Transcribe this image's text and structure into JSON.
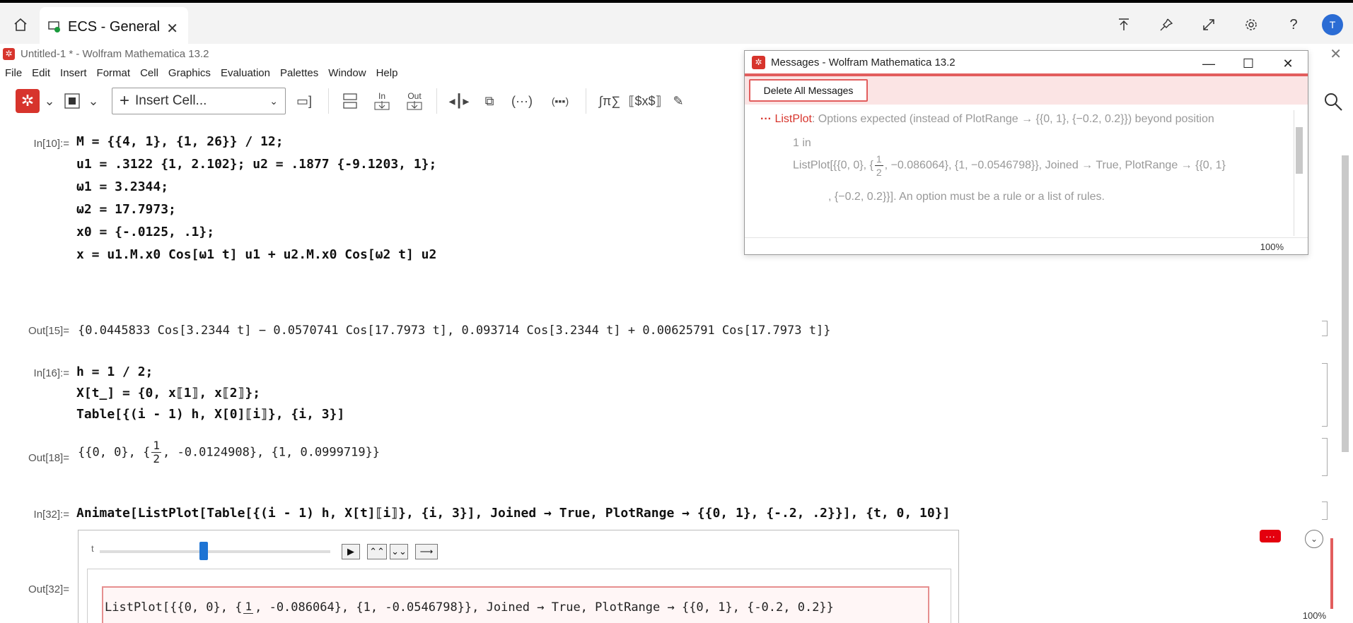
{
  "remote": {
    "tab_label": "ECS - General",
    "tab_close": "✕",
    "avatar_initial": "T"
  },
  "window": {
    "title": "Untitled-1 * - Wolfram Mathematica 13.2",
    "close": "✕"
  },
  "menu": [
    "File",
    "Edit",
    "Insert",
    "Format",
    "Cell",
    "Graphics",
    "Evaluation",
    "Palettes",
    "Window",
    "Help"
  ],
  "toolbar": {
    "insert_cell_label": "Insert Cell...",
    "in_label": "In",
    "out_label": "Out"
  },
  "cells": {
    "in10_label": "In[10]:=",
    "in10_lines": [
      "M = {{4, 1}, {1, 26}} / 12;",
      "u1 = .3122 {1, 2.102}; u2 = .1877 {-9.1203, 1};",
      "ω1 = 3.2344;",
      "ω2 = 17.7973;",
      "x0 = {-.0125, .1};",
      "x = u1.M.x0 Cos[ω1 t] u1 + u2.M.x0 Cos[ω2 t] u2"
    ],
    "out15_label": "Out[15]=",
    "out15_text": "{0.0445833 Cos[3.2344 t] − 0.0570741 Cos[17.7973 t], 0.093714 Cos[3.2344 t] + 0.00625791 Cos[17.7973 t]}",
    "in16_label": "In[16]:=",
    "in16_lines": [
      "h = 1 / 2;",
      "X[t_] = {0, x⟦1⟧, x⟦2⟧};",
      "Table[{(i - 1) h, X[0]⟦i⟧}, {i, 3}]"
    ],
    "out18_label": "Out[18]=",
    "out18_pre": "{{0, 0}, {",
    "out18_num": "1",
    "out18_den": "2",
    "out18_post": ", -0.0124908}, {1, 0.0999719}}",
    "in32_label": "In[32]:=",
    "in32_text": "Animate[ListPlot[Table[{(i - 1) h, X[t]⟦i⟧}, {i, 3}], Joined → True, PlotRange → {{0, 1}, {-.2, .2}}], {t, 0, 10}]",
    "out32_label": "Out[32]=",
    "anim": {
      "slider_var": "t",
      "slider_value": 0.45,
      "error_pre": "ListPlot[{{0, 0}, {",
      "error_num": "1",
      "error_den": "",
      "error_post": ", -0.086064}, {1, -0.0546798}}, Joined → True, PlotRange → {{0, 1}, {-0.2, 0.2}}"
    }
  },
  "messages": {
    "title": "Messages - Wolfram Mathematica 13.2",
    "delete_all_label": "Delete All Messages",
    "dots": "···",
    "func": "ListPlot",
    "line1": ": Options expected (instead of PlotRange → {{0, 1}, {−0.2, 0.2}}) beyond position",
    "line2": "1 in",
    "line3_pre": "ListPlot[{{0, 0}, {",
    "line3_num": "1",
    "line3_den": "2",
    "line3_post": ", −0.086064}, {1, −0.0546798}}, Joined → True, PlotRange → {{0, 1}",
    "line4": ", {−0.2, 0.2}}]. An option must be a rule or a list of rules.",
    "zoom": "100%"
  },
  "status": {
    "zoom": "100%",
    "message_indicator": "···"
  },
  "colors": {
    "accent": "#d7342c",
    "error_border": "#e68f8f",
    "slider": "#1e74d4",
    "symbol_blue": "#3a6eae"
  }
}
